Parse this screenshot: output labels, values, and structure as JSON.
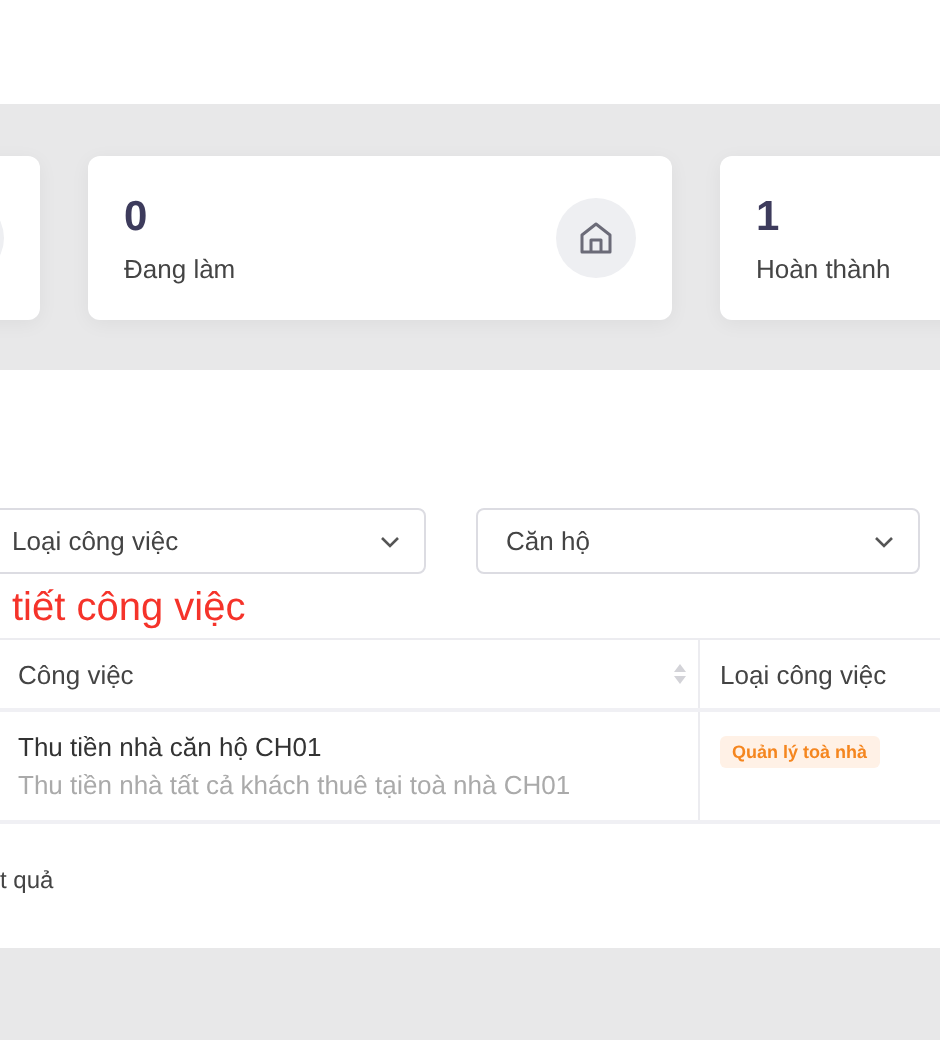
{
  "stats": [
    {
      "value": "0",
      "label": "Đang làm",
      "icon": true
    },
    {
      "value": "1",
      "label": "Hoàn thành"
    }
  ],
  "filters": [
    {
      "label": "Loại công việc"
    },
    {
      "label": "Căn hộ"
    }
  ],
  "section_title": "tiết công việc",
  "table": {
    "columns": [
      "Công việc",
      "Loại công việc"
    ],
    "rows": [
      {
        "title": "Thu tiền nhà căn hộ CH01",
        "description": "Thu tiền nhà tất cả khách thuê tại toà nhà CH01",
        "tag": "Quản lý toà nhà"
      }
    ]
  },
  "footer": "t quả"
}
